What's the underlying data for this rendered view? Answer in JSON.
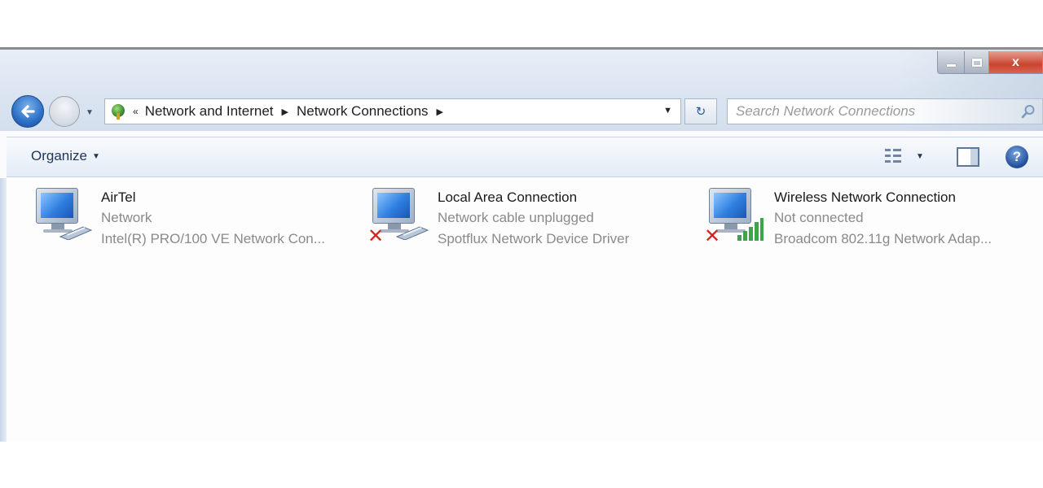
{
  "window": {
    "caption": {
      "close_glyph": "x"
    }
  },
  "nav": {
    "breadcrumbs": [
      "Network and Internet",
      "Network Connections"
    ],
    "search_placeholder": "Search Network Connections"
  },
  "toolbar": {
    "organize_label": "Organize",
    "help_glyph": "?"
  },
  "connections": [
    {
      "name": "AirTel",
      "status": "Network",
      "device": "Intel(R) PRO/100 VE Network Con...",
      "type": "wired",
      "error": false
    },
    {
      "name": "Local Area Connection",
      "status": "Network cable unplugged",
      "device": "Spotflux Network Device Driver",
      "type": "wired",
      "error": true
    },
    {
      "name": "Wireless Network Connection",
      "status": "Not connected",
      "device": "Broadcom 802.11g Network Adap...",
      "type": "wireless",
      "error": true
    }
  ],
  "icons": {
    "back": "back-arrow-icon",
    "forward": "forward-arrow-icon",
    "refresh": "refresh-icon",
    "search": "search-icon",
    "views": "views-icon",
    "preview_pane": "preview-pane-icon",
    "help": "help-icon",
    "error": "red-x-icon",
    "signal": "wifi-signal-icon"
  },
  "colors": {
    "accent": "#2b6fc6",
    "error": "#d8231c",
    "signal": "#3fa34a",
    "close_button": "#c9452f"
  }
}
